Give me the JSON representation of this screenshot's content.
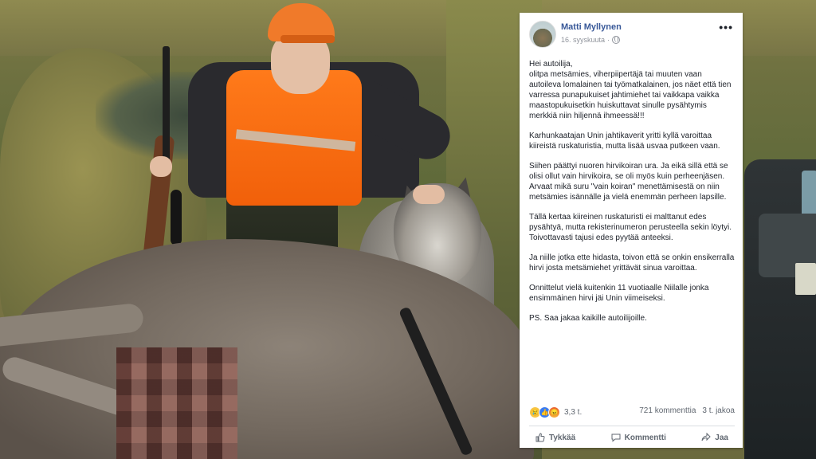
{
  "post": {
    "author": "Matti Myllynen",
    "date": "16. syyskuuta",
    "more_icon": "more-options-icon",
    "privacy_icon": "globe-icon",
    "paragraphs": [
      "Hei autoilija,\nolitpa metsämies, viherpiipertäjä tai muuten vaan autoileva lomalainen tai työmatkalainen, jos näet että tien varressa punapukuiset jahtimiehet tai vaikkapa vaikka maastopukuisetkin huiskuttavat sinulle pysähtymis merkkiä niin hiljennä ihmeessä!!!",
      "Karhunkaatajan Unin jahtikaverit yritti kyllä varoittaa kiireistä ruskaturistia, mutta lisää usvaa putkeen vaan.",
      "Siihen päättyi nuoren hirvikoiran ura. Ja eikä sillä että se olisi ollut vain hirvikoira, se oli myös kuin perheenjäsen. Arvaat mikä suru \"vain koiran\" menettämisestä on niin metsämies isännälle ja vielä enemmän perheen lapsille.",
      "Tällä kertaa kiireinen ruskaturisti ei malttanut edes pysähtyä, mutta rekisterinumeron perusteella sekin löytyi. Toivottavasti tajusi edes pyytää anteeksi.",
      "Ja niille jotka ette hidasta, toivon että se onkin ensikerralla hirvi josta metsämiehet yrittävät sinua varoittaa.",
      "Onnittelut vielä kuitenkin 11 vuotiaalle Niilalle jonka ensimmäinen hirvi jäi Unin viimeiseksi.",
      "PS. Saa jakaa kaikille autoilijoille."
    ],
    "reactions": {
      "icons": [
        "sad-reaction-icon",
        "like-reaction-icon",
        "angry-reaction-icon"
      ],
      "count": "3,3 t."
    },
    "comments": "721 kommenttia",
    "shares": "3 t. jakoa",
    "actions": {
      "like": "Tykkää",
      "comment": "Kommentti",
      "share": "Jaa"
    }
  },
  "colors": {
    "author_link": "#385898",
    "vest_orange": "#f1600a",
    "like_blue": "#3b7cf0"
  }
}
